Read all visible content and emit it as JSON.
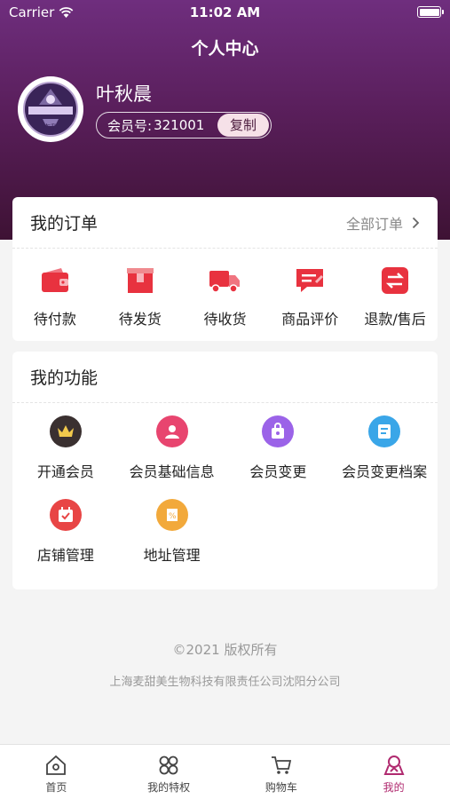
{
  "status_bar": {
    "carrier": "Carrier",
    "time": "11:02 AM"
  },
  "nav": {
    "title": "个人中心"
  },
  "profile": {
    "name": "叶秋晨",
    "member_label": "会员号:",
    "member_number": "321001",
    "copy_label": "复制",
    "avatar_text": "杏甜"
  },
  "orders": {
    "title": "我的订单",
    "all_label": "全部订单",
    "items": [
      {
        "label": "待付款",
        "icon": "wallet-icon"
      },
      {
        "label": "待发货",
        "icon": "box-icon"
      },
      {
        "label": "待收货",
        "icon": "truck-icon"
      },
      {
        "label": "商品评价",
        "icon": "review-icon"
      },
      {
        "label": "退款/售后",
        "icon": "refund-icon"
      }
    ]
  },
  "functions": {
    "title": "我的功能",
    "items": [
      {
        "label": "开通会员",
        "icon": "crown-icon",
        "color": "#3a3030"
      },
      {
        "label": "会员基础信息",
        "icon": "member-info-icon",
        "color": "#e8456f"
      },
      {
        "label": "会员变更",
        "icon": "member-change-icon",
        "color": "#9b63e8"
      },
      {
        "label": "会员变更档案",
        "icon": "archive-icon",
        "color": "#3aa6e8"
      },
      {
        "label": "店铺管理",
        "icon": "calendar-icon",
        "color": "#e84545"
      },
      {
        "label": "地址管理",
        "icon": "coupon-icon",
        "color": "#f2a93b"
      }
    ]
  },
  "footer": {
    "copyright": "©2021 版权所有",
    "company": "上海麦甜美生物科技有限责任公司沈阳分公司"
  },
  "tabbar": {
    "items": [
      {
        "label": "首页",
        "icon": "home-icon"
      },
      {
        "label": "我的特权",
        "icon": "grid-icon"
      },
      {
        "label": "购物车",
        "icon": "cart-icon"
      },
      {
        "label": "我的",
        "icon": "user-icon",
        "active": true
      }
    ]
  },
  "colors": {
    "accent": "#b02a6f",
    "header": "#5a1f5c",
    "icon_red": "#e8323f"
  }
}
